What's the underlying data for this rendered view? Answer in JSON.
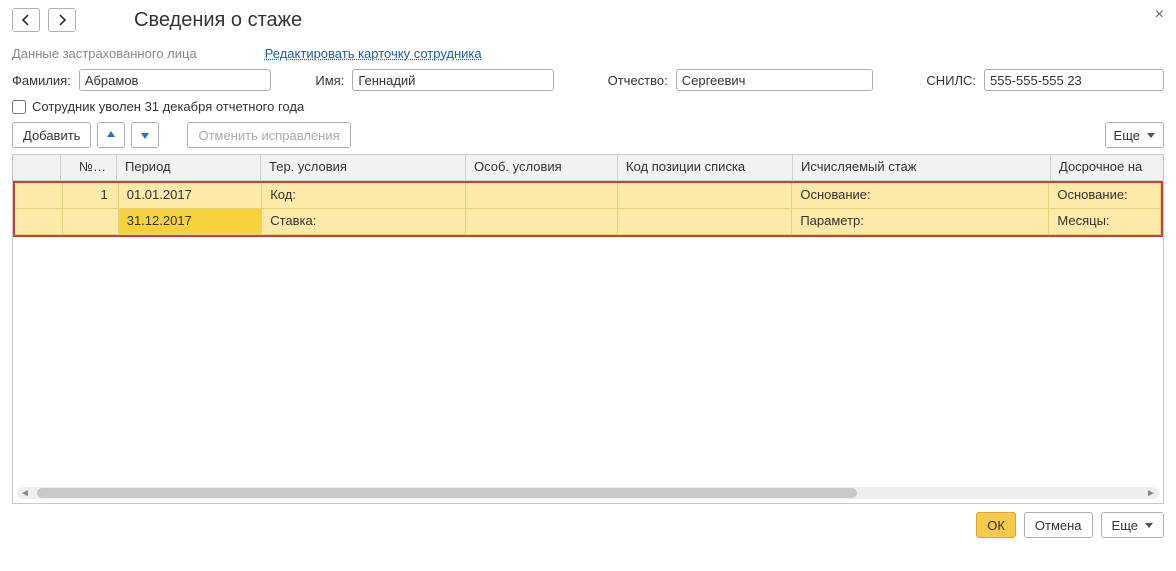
{
  "header": {
    "title": "Сведения о стаже"
  },
  "form": {
    "section_label": "Данные застрахованного лица",
    "edit_link": "Редактировать карточку сотрудника",
    "surname_label": "Фамилия:",
    "surname_value": "Абрамов",
    "name_label": "Имя:",
    "name_value": "Геннадий",
    "patronymic_label": "Отчество:",
    "patronymic_value": "Сергеевич",
    "snils_label": "СНИЛС:",
    "snils_value": "555-555-555 23",
    "fired_checkbox_label": "Сотрудник уволен 31 декабря отчетного года",
    "fired_checked": false
  },
  "toolbar": {
    "add_label": "Добавить",
    "undo_label": "Отменить исправления",
    "more_label": "Еще"
  },
  "grid": {
    "columns": {
      "num": "№…",
      "period": "Период",
      "ter": "Тер. условия",
      "osob": "Особ. условия",
      "kod": "Код позиции списка",
      "isch": "Исчисляемый стаж",
      "dosr": "Досрочное на"
    },
    "row": {
      "num": "1",
      "period_start": "01.01.2017",
      "period_end": "31.12.2017",
      "ter_code_label": "Код:",
      "ter_rate_label": "Ставка:",
      "isch_basis_label": "Основание:",
      "isch_param_label": "Параметр:",
      "dosr_basis_label": "Основание:",
      "dosr_months_label": "Месяцы:"
    }
  },
  "footer": {
    "ok": "ОК",
    "cancel": "Отмена",
    "more": "Еще"
  }
}
